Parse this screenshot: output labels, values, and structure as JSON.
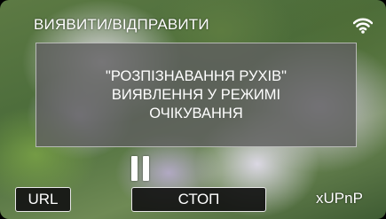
{
  "header": {
    "title": "ВИЯВИТИ/ВІДПРАВИТИ",
    "wifi_icon": "wifi-icon"
  },
  "message": {
    "line1": "\"РОЗПІЗНАВАННЯ РУХІВ\"",
    "line2": "ВИЯВЛЕННЯ У РЕЖИМІ",
    "line3": "ОЧІКУВАННЯ"
  },
  "status": {
    "pause_icon": "pause-icon"
  },
  "buttons": {
    "url_label": "URL",
    "stop_label": "СТОП"
  },
  "indicator": {
    "xupnp_label": "xUPnP"
  }
}
